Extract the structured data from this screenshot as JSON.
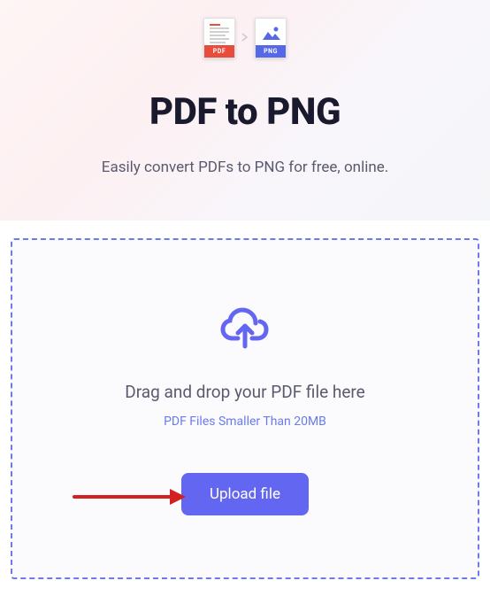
{
  "hero": {
    "source_format": "PDF",
    "target_format": "PNG",
    "title": "PDF to PNG",
    "subtitle": "Easily convert PDFs to PNG for free, online."
  },
  "dropzone": {
    "drag_text": "Drag and drop your PDF file here",
    "size_text": "PDF Files Smaller Than 20MB",
    "upload_button_label": "Upload file"
  },
  "colors": {
    "primary": "#6366f1",
    "border_dashed": "#6b7be8",
    "pdf_red": "#e74c3c",
    "png_blue": "#5568e8",
    "annotation_red": "#d32020"
  }
}
